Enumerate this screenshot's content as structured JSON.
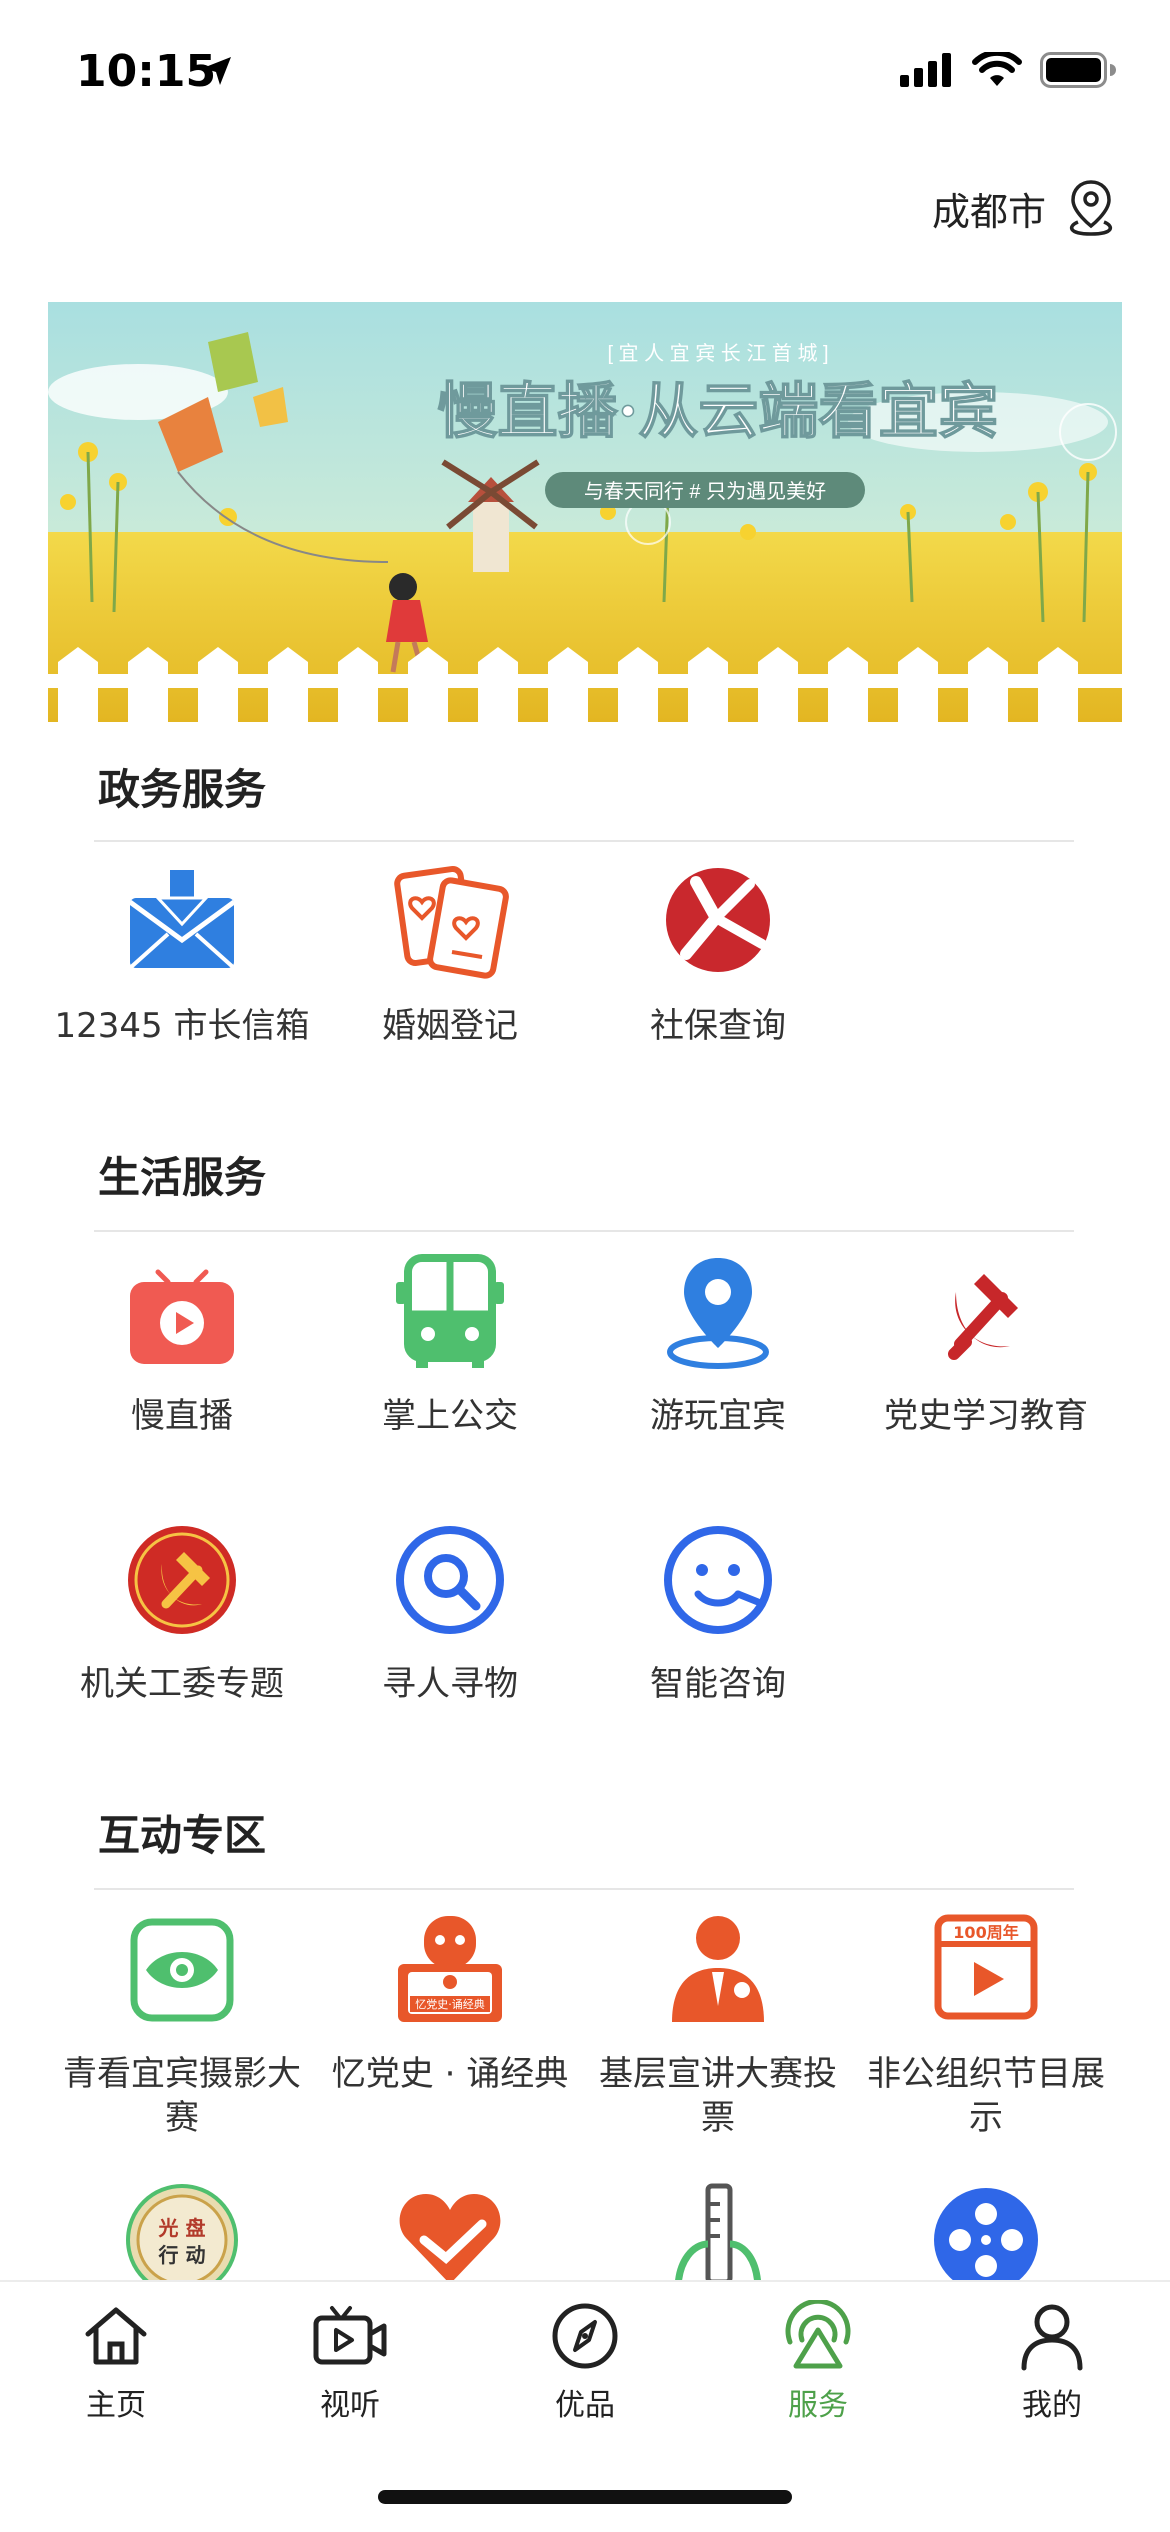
{
  "status": {
    "time": "10:15"
  },
  "location": {
    "city": "成都市"
  },
  "banner": {
    "top_tag": "[ 宜 人 宜 宾      长 江 首 城 ]",
    "headline": "慢直播·从云端看宜宾",
    "subline": "与春天同行 # 只为遇见美好"
  },
  "sections": [
    {
      "title": "政务服务",
      "items": [
        {
          "label": "12345 市长信箱",
          "icon": "mail-download-icon"
        },
        {
          "label": "婚姻登记",
          "icon": "certificate-heart-icon"
        },
        {
          "label": "社保查询",
          "icon": "social-security-icon"
        }
      ]
    },
    {
      "title": "生活服务",
      "items": [
        {
          "label": "慢直播",
          "icon": "live-tv-icon"
        },
        {
          "label": "掌上公交",
          "icon": "bus-icon"
        },
        {
          "label": "游玩宜宾",
          "icon": "map-pin-icon"
        },
        {
          "label": "党史学习教育",
          "icon": "party-emblem-icon"
        },
        {
          "label": "机关工委专题",
          "icon": "party-badge-icon"
        },
        {
          "label": "寻人寻物",
          "icon": "search-circle-icon"
        },
        {
          "label": "智能咨询",
          "icon": "smile-headset-icon"
        }
      ]
    },
    {
      "title": "互动专区",
      "items": [
        {
          "label": "青看宜宾摄影大赛",
          "icon": "eye-camera-icon"
        },
        {
          "label": "忆党史 · 诵经典",
          "icon": "party-book-icon"
        },
        {
          "label": "基层宣讲大赛投票",
          "icon": "speaker-person-icon"
        },
        {
          "label": "非公组织节目展示",
          "icon": "video-100-icon"
        }
      ],
      "badge_100": "100周年",
      "book_text": "忆党史·诵经典"
    }
  ],
  "more_row": {
    "badge_top": "光 盘",
    "badge_bottom": "行 动"
  },
  "tabbar": {
    "items": [
      {
        "label": "主页",
        "icon": "home-icon"
      },
      {
        "label": "视听",
        "icon": "video-camera-icon"
      },
      {
        "label": "优品",
        "icon": "compass-icon"
      },
      {
        "label": "服务",
        "icon": "broadcast-icon",
        "active": true
      },
      {
        "label": "我的",
        "icon": "user-icon"
      }
    ],
    "active_color": "#4ea14a"
  }
}
